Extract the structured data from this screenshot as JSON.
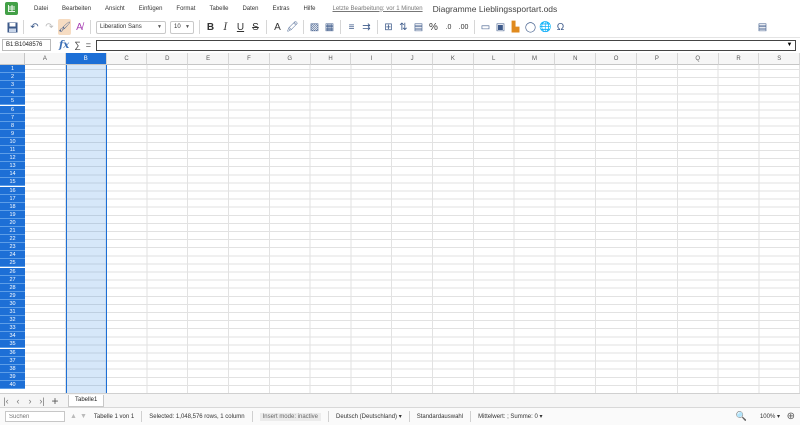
{
  "menubar": {
    "items": [
      "Datei",
      "Bearbeiten",
      "Ansicht",
      "Einfügen",
      "Format",
      "Tabelle",
      "Daten",
      "Extras",
      "Hilfe"
    ],
    "last_edit": "Letzte Bearbeitung: vor 1 Minuten",
    "doc_title": "Diagramme Lieblingssportart.ods"
  },
  "toolbar": {
    "font_name": "Liberation Sans",
    "font_size": "10"
  },
  "formulabar": {
    "namebox": "B1:B1048576"
  },
  "grid": {
    "columns": [
      "A",
      "B",
      "C",
      "D",
      "E",
      "F",
      "G",
      "H",
      "I",
      "J",
      "K",
      "L",
      "M",
      "N",
      "O",
      "P",
      "Q",
      "R",
      "S"
    ],
    "selected_column": "B",
    "rows": [
      "1",
      "2",
      "3",
      "4",
      "5",
      "6",
      "7",
      "8",
      "9",
      "10",
      "11",
      "12",
      "13",
      "14",
      "15",
      "16",
      "17",
      "18",
      "19",
      "20",
      "21",
      "22",
      "23",
      "24",
      "25",
      "26",
      "27",
      "28",
      "29",
      "30",
      "31",
      "32",
      "33",
      "34",
      "35",
      "36",
      "37",
      "38",
      "39",
      "40"
    ]
  },
  "tabs": {
    "sheets": [
      "Tabelle1"
    ]
  },
  "statusbar": {
    "search_placeholder": "Suchen",
    "sheet_info": "Tabelle 1 von 1",
    "selection_info": "Selected: 1,048,576 rows, 1 column",
    "insert_mode": "Insert mode: inactive",
    "language": "Deutsch (Deutschland)",
    "selection_mode": "Standardauswahl",
    "average_sum": "Mittelwert: ; Summe: 0",
    "zoom": "100%"
  },
  "colors": {
    "accent": "#1d6fd6",
    "selection": "#cfe4f7",
    "app_icon": "#43a047"
  }
}
